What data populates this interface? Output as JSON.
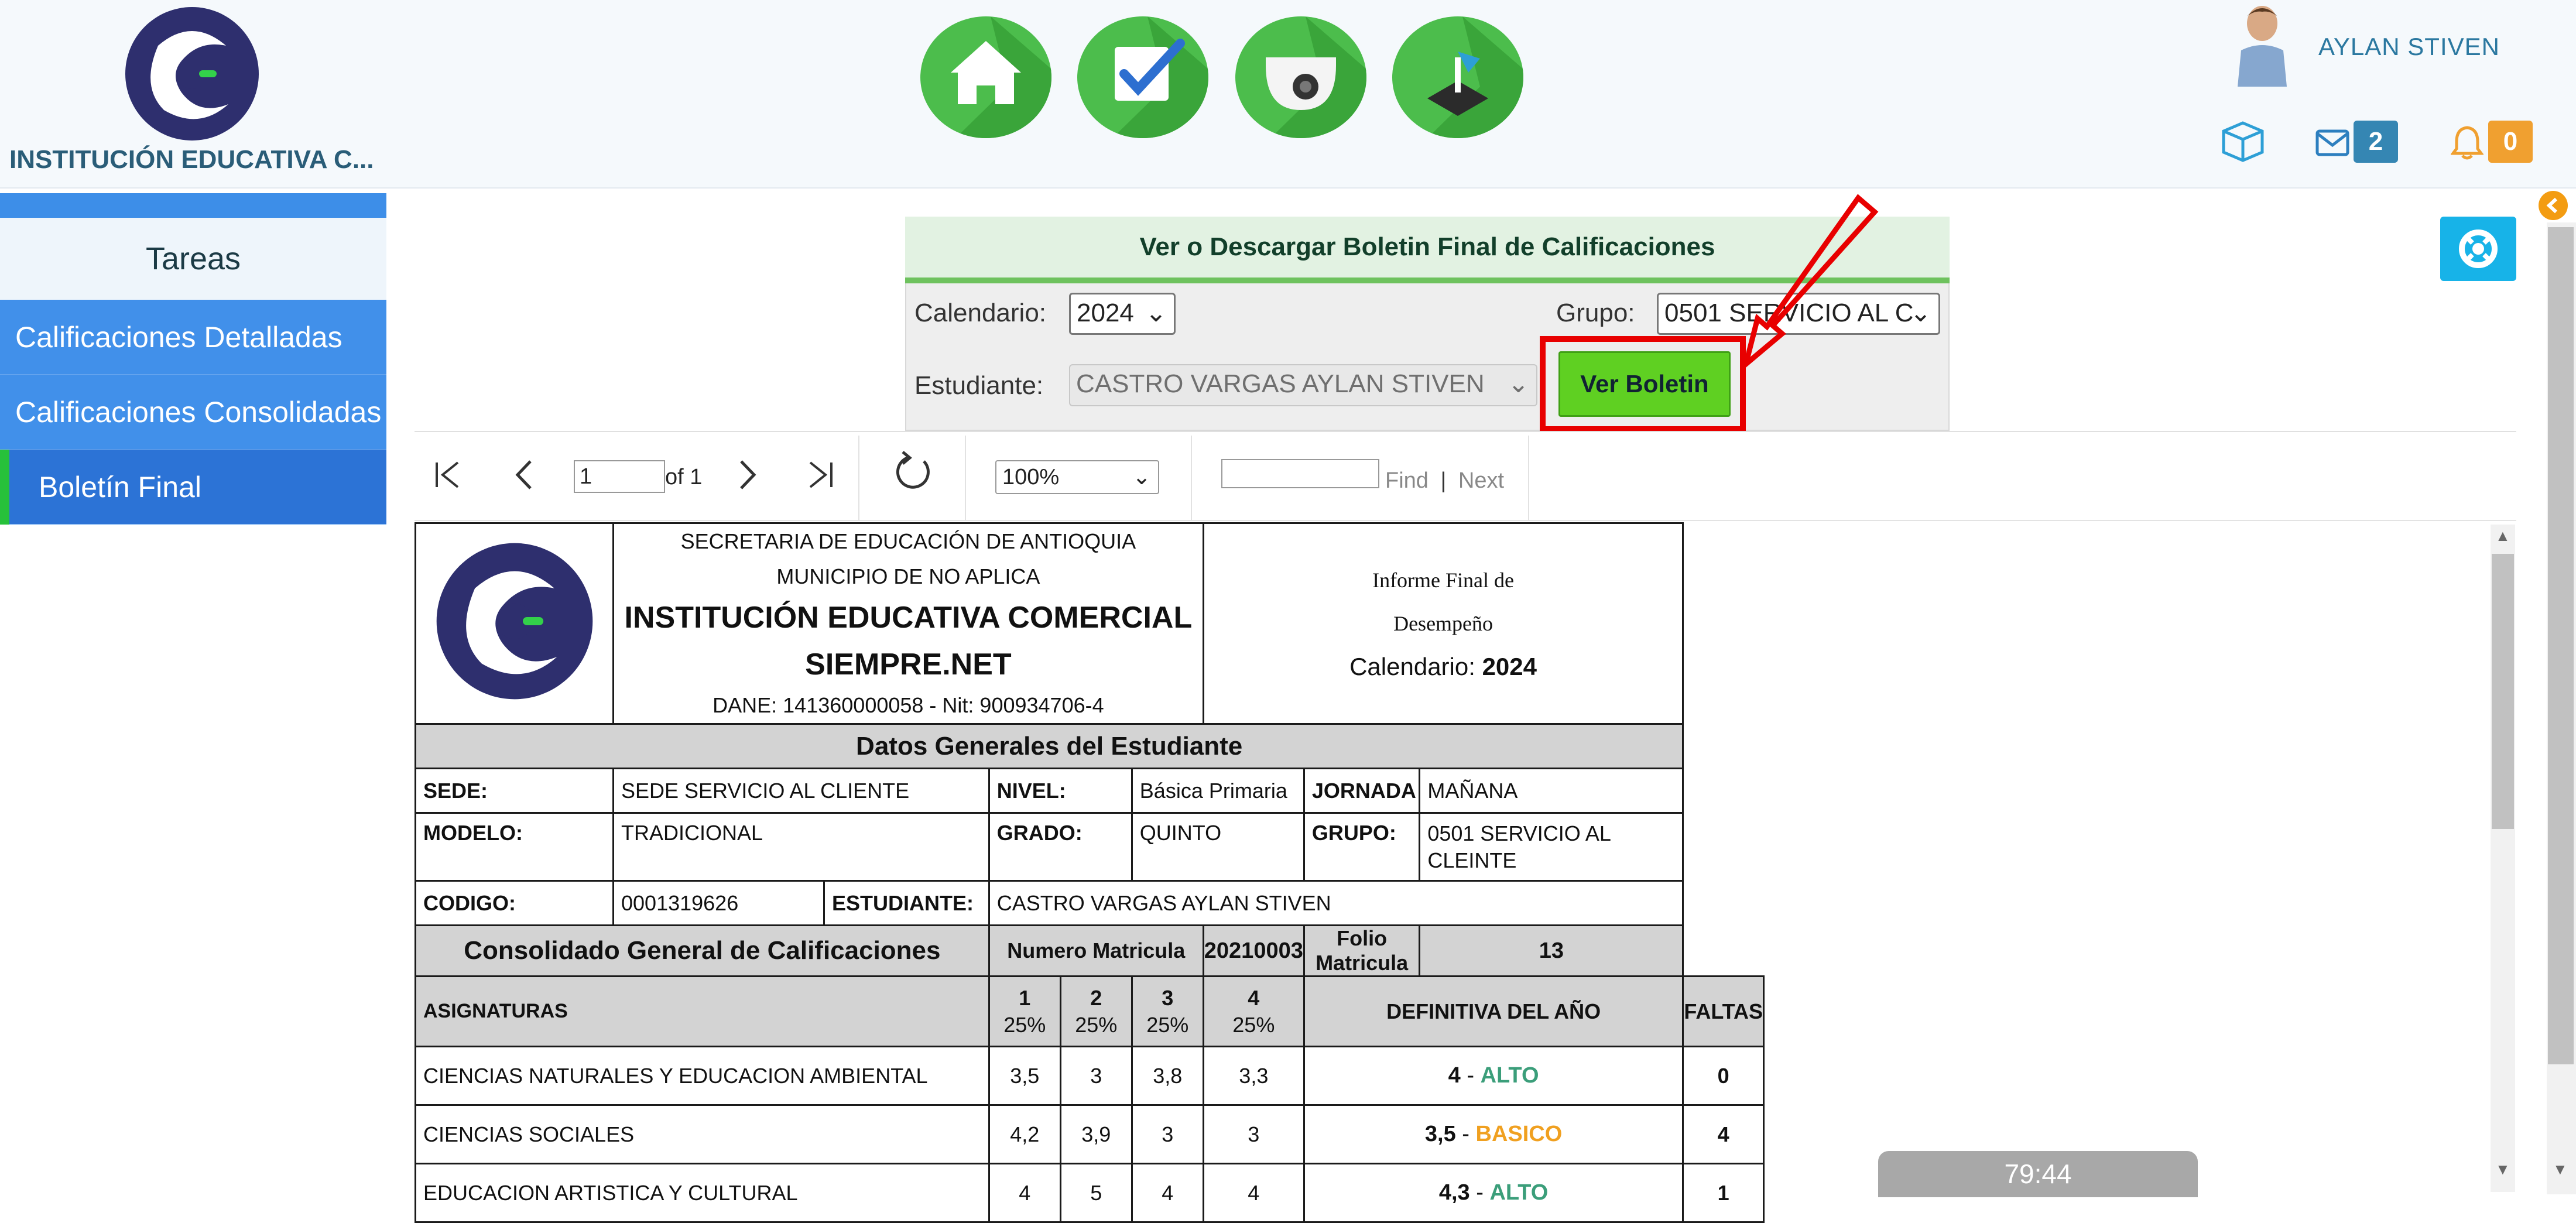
{
  "header": {
    "institution_short": "INSTITUCIÓN EDUCATIVA C...",
    "user_name": "AYLAN STIVEN",
    "mail_count": "2",
    "notification_count": "0"
  },
  "sidebar": {
    "title": "Tareas",
    "items": [
      {
        "label": "Calificaciones Detalladas"
      },
      {
        "label": "Calificaciones Consolidadas"
      },
      {
        "label": "Boletín Final"
      }
    ]
  },
  "form": {
    "title": "Ver o Descargar  Boletin Final de Calificaciones",
    "calendario_label": "Calendario:",
    "calendario_value": "2024",
    "grupo_label": "Grupo:",
    "grupo_value": "0501 SERVICIO AL C",
    "estudiante_label": "Estudiante:",
    "estudiante_value": "CASTRO VARGAS AYLAN STIVEN",
    "ver_button": "Ver Boletin"
  },
  "viewer": {
    "page_value": "1",
    "page_of": "of 1",
    "zoom": "100%",
    "find": "Find",
    "separator": "|",
    "next": "Next"
  },
  "report": {
    "line1": "SECRETARIA DE EDUCACIÓN DE ANTIOQUIA",
    "line2": "MUNICIPIO DE NO APLICA",
    "line3": "INSTITUCIÓN EDUCATIVA COMERCIAL SIEMPRE.NET",
    "line4": "DANE: 141360000058 - Nit: 900934706-4",
    "right1": "Informe Final de",
    "right2": "Desempeño",
    "right3_label": "Calendario:",
    "right3_value": "2024",
    "datos_title": "Datos Generales del Estudiante",
    "sede_label": "SEDE:",
    "sede_value": "SEDE SERVICIO AL CLIENTE",
    "nivel_label": "NIVEL:",
    "nivel_value": "Básica Primaria",
    "jornada_label": "JORNADA",
    "jornada_value": "MAÑANA",
    "modelo_label": "MODELO:",
    "modelo_value": "TRADICIONAL",
    "grado_label": "GRADO:",
    "grado_value": "QUINTO",
    "grupo_label": "GRUPO:",
    "grupo_value": "0501 SERVICIO AL CLEINTE",
    "codigo_label": "CODIGO:",
    "codigo_value": "0001319626",
    "estudiante_label": "ESTUDIANTE:",
    "estudiante_value": "CASTRO VARGAS AYLAN STIVEN",
    "consolidado_title": "Consolidado General de Calificaciones",
    "num_matricula_label": "Numero Matricula",
    "num_matricula_value": "20210003",
    "folio_label": "Folio Matricula",
    "folio_value": "13",
    "asignaturas_label": "ASIGNATURAS",
    "periods": [
      {
        "n": "1",
        "p": "25%"
      },
      {
        "n": "2",
        "p": "25%"
      },
      {
        "n": "3",
        "p": "25%"
      },
      {
        "n": "4",
        "p": "25%"
      }
    ],
    "definitiva_label": "DEFINITIVA DEL AÑO",
    "faltas_label": "FALTAS",
    "subjects": [
      {
        "name": "CIENCIAS NATURALES Y EDUCACION AMBIENTAL",
        "g1": "3,5",
        "g2": "3",
        "g3": "3,8",
        "g4": "3,3",
        "def": "4",
        "sep": " - ",
        "level": "ALTO",
        "faltas": "0"
      },
      {
        "name": "CIENCIAS SOCIALES",
        "g1": "4,2",
        "g2": "3,9",
        "g3": "3",
        "g4": "3",
        "def": "3,5",
        "sep": " - ",
        "level": "BASICO",
        "faltas": "4"
      },
      {
        "name": "EDUCACION ARTISTICA Y CULTURAL",
        "g1": "4",
        "g2": "5",
        "g3": "4",
        "g4": "4",
        "def": "4,3",
        "sep": " - ",
        "level": "ALTO",
        "faltas": "1"
      }
    ]
  },
  "timer": "79:44",
  "colors": {
    "sidebar_blue": "#4190ea",
    "active_blue": "#2c73d6",
    "nav_green": "#4cbd4c",
    "ver_green": "#5fd022",
    "annotation_red": "#e80000",
    "alto": "#3b9e7a",
    "basico": "#f0a020"
  }
}
